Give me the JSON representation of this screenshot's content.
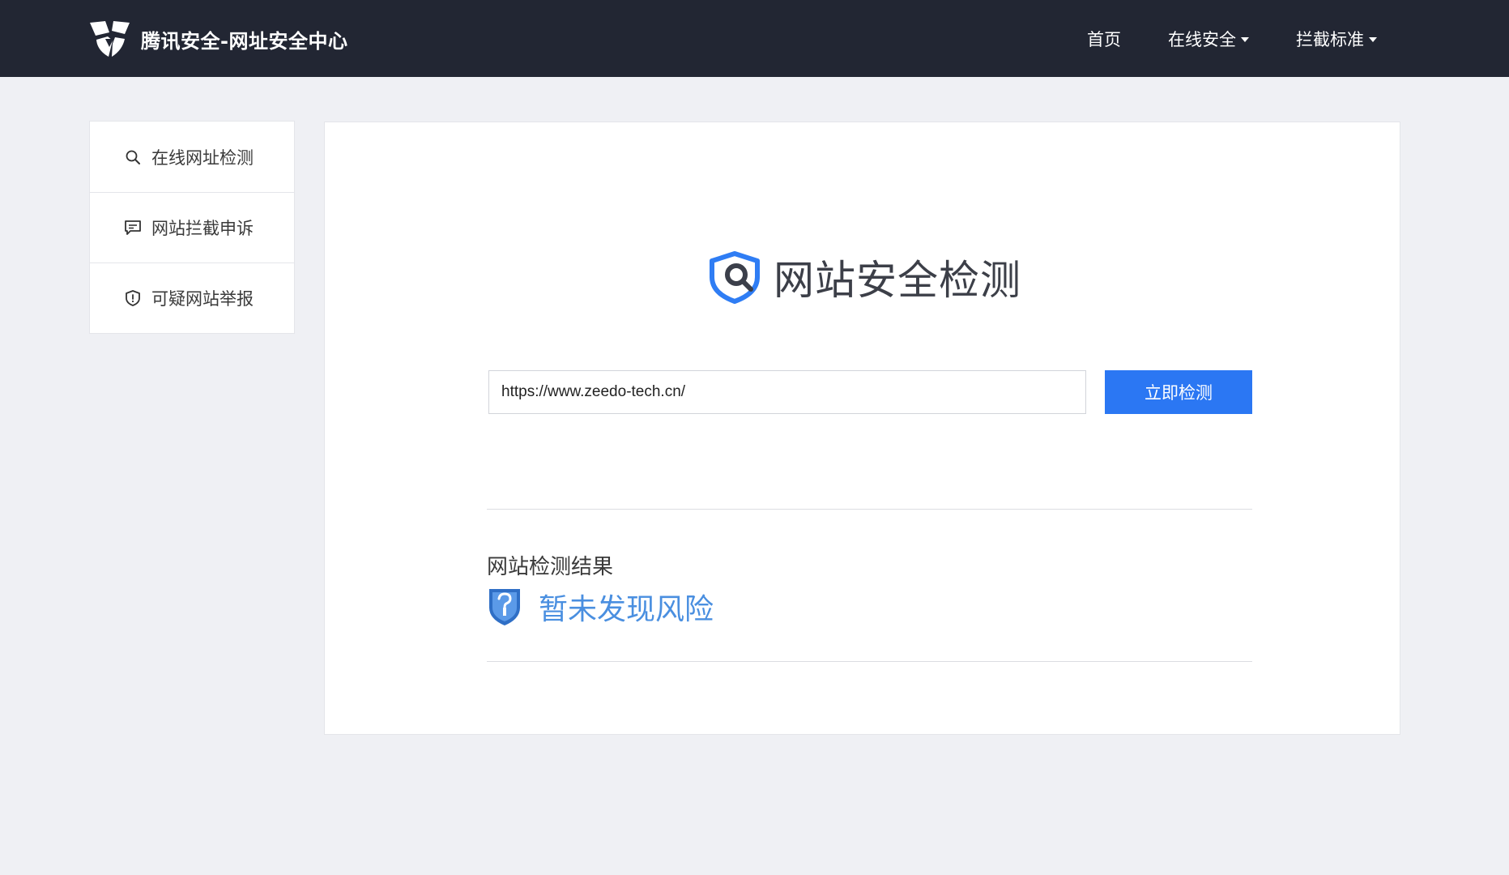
{
  "header": {
    "brand_title": "腾讯安全-网址安全中心",
    "logo_icon": "tencent-security-logo",
    "nav": [
      {
        "label": "首页",
        "has_dropdown": false
      },
      {
        "label": "在线安全",
        "has_dropdown": true
      },
      {
        "label": "拦截标准",
        "has_dropdown": true
      }
    ]
  },
  "sidebar": {
    "items": [
      {
        "label": "在线网址检测",
        "icon": "search-icon"
      },
      {
        "label": "网站拦截申诉",
        "icon": "message-icon"
      },
      {
        "label": "可疑网站举报",
        "icon": "shield-alert-icon"
      }
    ]
  },
  "main": {
    "title": "网站安全检测",
    "title_icon": "shield-search-icon",
    "url_value": "https://www.zeedo-tech.cn/",
    "check_button": "立即检测",
    "result_heading": "网站检测结果",
    "result_text": "暂未发现风险",
    "result_icon": "shield-unknown-icon"
  },
  "colors": {
    "header_bg": "#222633",
    "page_bg": "#eff0f4",
    "accent": "#2b77f3",
    "result_text": "#4a8fe0"
  }
}
